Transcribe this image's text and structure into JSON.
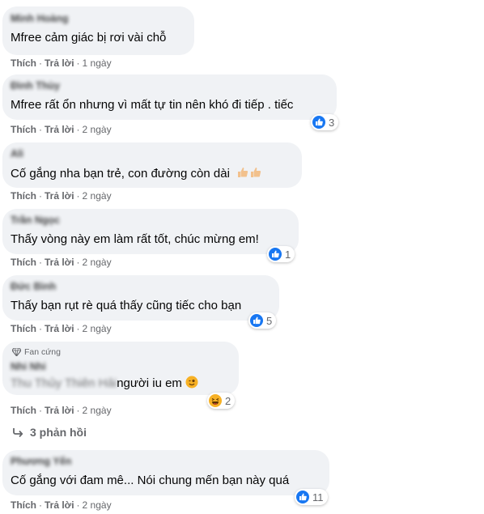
{
  "comments": [
    {
      "author": "Minh Hoàng",
      "text": "Mfree cảm giác bị rơi vài chỗ",
      "like": "Thích",
      "reply": "Trả lời",
      "time": "1 ngày"
    },
    {
      "author": "Đình Thùy",
      "text": "Mfree rất ổn nhưng vì mất tự tin nên khó đi tiếp . tiếc",
      "like": "Thích",
      "reply": "Trả lời",
      "time": "2 ngày",
      "reactions": "3"
    },
    {
      "author": "Ali",
      "text": "Cố gắng nha bạn trẻ, con đường còn dài",
      "like": "Thích",
      "reply": "Trả lời",
      "time": "2 ngày"
    },
    {
      "author": "Trần Ngọc",
      "text": "Thấy vòng này em làm rất tốt, chúc mừng em!",
      "like": "Thích",
      "reply": "Trả lời",
      "time": "2 ngày",
      "reactions": "1"
    },
    {
      "author": "Đức Bình",
      "text": "Thấy bạn rụt rè quá thấy cũng tiếc cho bạn",
      "like": "Thích",
      "reply": "Trả lời",
      "time": "2 ngày",
      "reactions": "5"
    },
    {
      "badge": "Fan cứng",
      "author": "Nhi Nhi",
      "mention": "Thu Thủy Thiên Hải",
      "text": "người iu em",
      "like": "Thích",
      "reply": "Trả lời",
      "time": "2 ngày",
      "reactions": "2"
    },
    {
      "author": "Phương Yến",
      "text": "Cố gắng với đam mê... Nói chung mến bạn này quá",
      "like": "Thích",
      "reply": "Trả lời",
      "time": "2 ngày",
      "reactions": "11"
    }
  ],
  "replies_label": "3 phản hồi",
  "colors": {
    "bubble": "#f0f2f5",
    "like_blue": "#1877f2",
    "meta": "#65676b",
    "haha": "#f7b125"
  },
  "icons": {
    "like": "like-reaction-icon",
    "haha": "haha-reaction-icon",
    "badge": "diamond-icon",
    "reply_arrow": "reply-arrow-icon",
    "thumbs": "thumbs-up-emoji"
  }
}
